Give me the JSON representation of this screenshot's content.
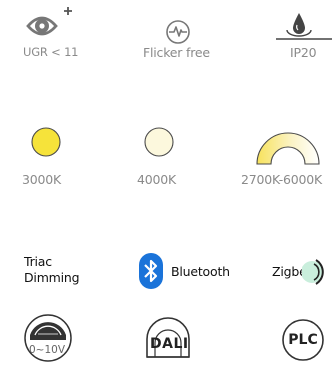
{
  "features": [
    {
      "id": "ugr",
      "icon": "eye-plus-icon",
      "label": "UGR < 11"
    },
    {
      "id": "flicker",
      "icon": "heartbeat-circle-icon",
      "label": "Flicker free"
    },
    {
      "id": "ip",
      "icon": "water-drop-icon",
      "label": "IP20"
    }
  ],
  "color_temps": [
    {
      "id": "warm",
      "label": "3000K",
      "color": "#F6E33A"
    },
    {
      "id": "neutral",
      "label": "4000K",
      "color": "#FCF8DD"
    },
    {
      "id": "tunable",
      "label": "2700K-6000K",
      "color": "#F7EE9A"
    }
  ],
  "controls": {
    "triac": {
      "line1": "Triac",
      "line2": "Dimming"
    },
    "bluetooth": {
      "label": "Bluetooth",
      "icon": "bluetooth-icon",
      "color": "#1A73D9"
    },
    "zigbee": {
      "label": "Zigbee",
      "icon": "zigbee-wave-icon"
    },
    "analog": {
      "label": "0~10V",
      "icon": "dimmer-dial-icon"
    },
    "dali": {
      "label": "DALI",
      "icon": "dali-dome-icon"
    },
    "plc": {
      "label": "PLC",
      "icon": "plc-circle-icon"
    }
  }
}
